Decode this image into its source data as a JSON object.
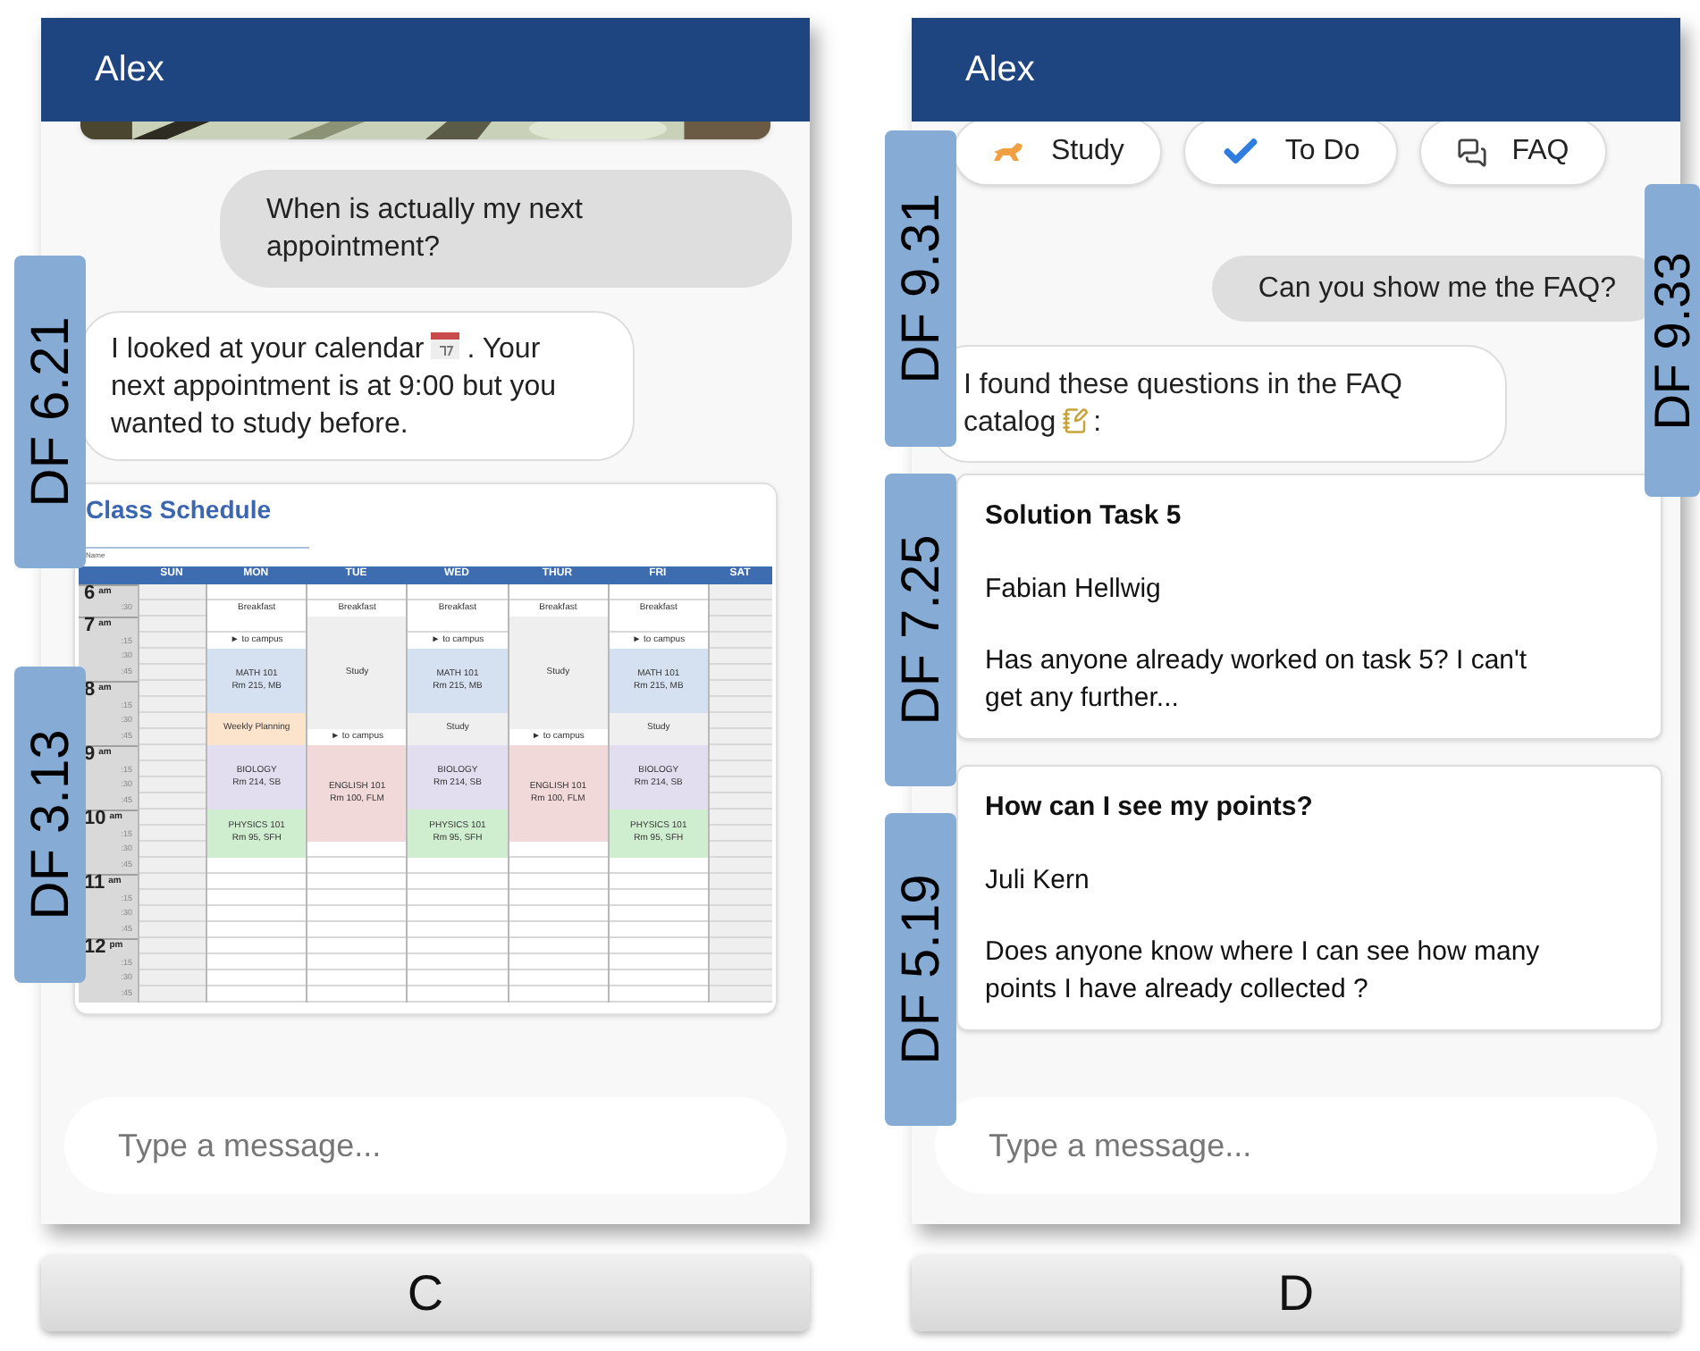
{
  "panels": [
    {
      "label": "C",
      "header": "Alex",
      "badges": [
        "DF 6.21",
        "DF 3.13"
      ],
      "messages": [
        {
          "kind": "picture"
        },
        {
          "kind": "user",
          "text": "When is actually my next appointment?"
        },
        {
          "kind": "bot",
          "before": "I looked at your calendar",
          "after": ". Your next appointment is at 9:00 but you wanted to study before."
        },
        {
          "kind": "schedule",
          "title": "Class Schedule",
          "name_label": "Name",
          "times": [
            {
              "hour": "6",
              "period": "am",
              "slots": [
                ":30"
              ]
            },
            {
              "hour": "7",
              "period": "am",
              "slots": [
                ":15",
                ":30",
                ":45"
              ]
            },
            {
              "hour": "8",
              "period": "am",
              "slots": [
                ":15",
                ":30",
                ":45"
              ]
            },
            {
              "hour": "9",
              "period": "am",
              "slots": [
                ":15",
                ":30",
                ":45"
              ]
            },
            {
              "hour": "10",
              "period": "am",
              "slots": [
                ":15",
                ":30",
                ":45"
              ]
            },
            {
              "hour": "11",
              "period": "am",
              "slots": [
                ":15",
                ":30",
                ":45"
              ]
            },
            {
              "hour": "12",
              "period": "pm",
              "slots": [
                ":15",
                ":30",
                ":45"
              ]
            }
          ],
          "days": [
            {
              "label": "SUN",
              "weekend": true
            },
            {
              "label": "MON",
              "weekend": false,
              "events": [
                {
                  "color": "#ffffff",
                  "lines": [
                    "Breakfast"
                  ]
                },
                {
                  "color": "#ffffff",
                  "lines": [
                    "► to campus"
                  ]
                },
                {
                  "color": "#d5e1f0",
                  "lines": [
                    "MATH 101",
                    "Rm 215, MB"
                  ]
                },
                {
                  "color": "#fbe3cc",
                  "lines": [
                    "Weekly Planning"
                  ]
                },
                {
                  "color": "#e2ddef",
                  "lines": [
                    "BIOLOGY",
                    "Rm 214, SB"
                  ]
                },
                {
                  "color": "#cfeecf",
                  "lines": [
                    "PHYSICS 101",
                    "Rm 95, SFH"
                  ]
                }
              ]
            },
            {
              "label": "TUE",
              "weekend": false,
              "events": [
                {
                  "color": "#ffffff",
                  "lines": [
                    "Breakfast"
                  ]
                },
                {
                  "color": "#efefef",
                  "lines": [
                    "Study"
                  ]
                },
                {
                  "color": "#ffffff",
                  "lines": [
                    "► to campus"
                  ]
                },
                {
                  "color": "#f2d9d9",
                  "lines": [
                    "ENGLISH 101",
                    "Rm 100, FLM"
                  ]
                }
              ]
            },
            {
              "label": "WED",
              "weekend": false,
              "events": [
                {
                  "color": "#ffffff",
                  "lines": [
                    "Breakfast"
                  ]
                },
                {
                  "color": "#ffffff",
                  "lines": [
                    "► to campus"
                  ]
                },
                {
                  "color": "#d5e1f0",
                  "lines": [
                    "MATH 101",
                    "Rm 215, MB"
                  ]
                },
                {
                  "color": "#efefef",
                  "lines": [
                    "Study"
                  ]
                },
                {
                  "color": "#e2ddef",
                  "lines": [
                    "BIOLOGY",
                    "Rm 214, SB"
                  ]
                },
                {
                  "color": "#cfeecf",
                  "lines": [
                    "PHYSICS 101",
                    "Rm 95, SFH"
                  ]
                }
              ]
            },
            {
              "label": "THUR",
              "weekend": false,
              "events": [
                {
                  "color": "#ffffff",
                  "lines": [
                    "Breakfast"
                  ]
                },
                {
                  "color": "#efefef",
                  "lines": [
                    "Study"
                  ]
                },
                {
                  "color": "#ffffff",
                  "lines": [
                    "► to campus"
                  ]
                },
                {
                  "color": "#f2d9d9",
                  "lines": [
                    "ENGLISH 101",
                    "Rm 100, FLM"
                  ]
                }
              ]
            },
            {
              "label": "FRI",
              "weekend": false,
              "events": [
                {
                  "color": "#ffffff",
                  "lines": [
                    "Breakfast"
                  ]
                },
                {
                  "color": "#ffffff",
                  "lines": [
                    "► to campus"
                  ]
                },
                {
                  "color": "#d5e1f0",
                  "lines": [
                    "MATH 101",
                    "Rm 215, MB"
                  ]
                },
                {
                  "color": "#efefef",
                  "lines": [
                    "Study"
                  ]
                },
                {
                  "color": "#e2ddef",
                  "lines": [
                    "BIOLOGY",
                    "Rm 214, SB"
                  ]
                },
                {
                  "color": "#cfeecf",
                  "lines": [
                    "PHYSICS 101",
                    "Rm 95, SFH"
                  ]
                }
              ]
            },
            {
              "label": "SAT",
              "weekend": true
            }
          ]
        }
      ],
      "input_placeholder": "Type a message..."
    },
    {
      "label": "D",
      "header": "Alex",
      "badges": [
        "DF 9.31",
        "DF 7.25",
        "DF 5.19",
        "DF 9.33"
      ],
      "messages": [
        {
          "kind": "chips",
          "items": [
            "Study",
            "To Do",
            "FAQ"
          ]
        },
        {
          "kind": "user",
          "text": "Can you show me the FAQ?"
        },
        {
          "kind": "bot",
          "before": "I found these questions in the FAQ catalog",
          "after": ":"
        },
        {
          "kind": "faq",
          "title": "Solution Task 5",
          "author": "Fabian Hellwig",
          "text": "Has anyone already worked on task 5? I can't get any further..."
        },
        {
          "kind": "faq",
          "title": "How can I see my points?",
          "author": "Juli Kern",
          "text": "Does anyone know where I can see how many points I have already collected ?"
        }
      ],
      "input_placeholder": "Type a message..."
    }
  ]
}
